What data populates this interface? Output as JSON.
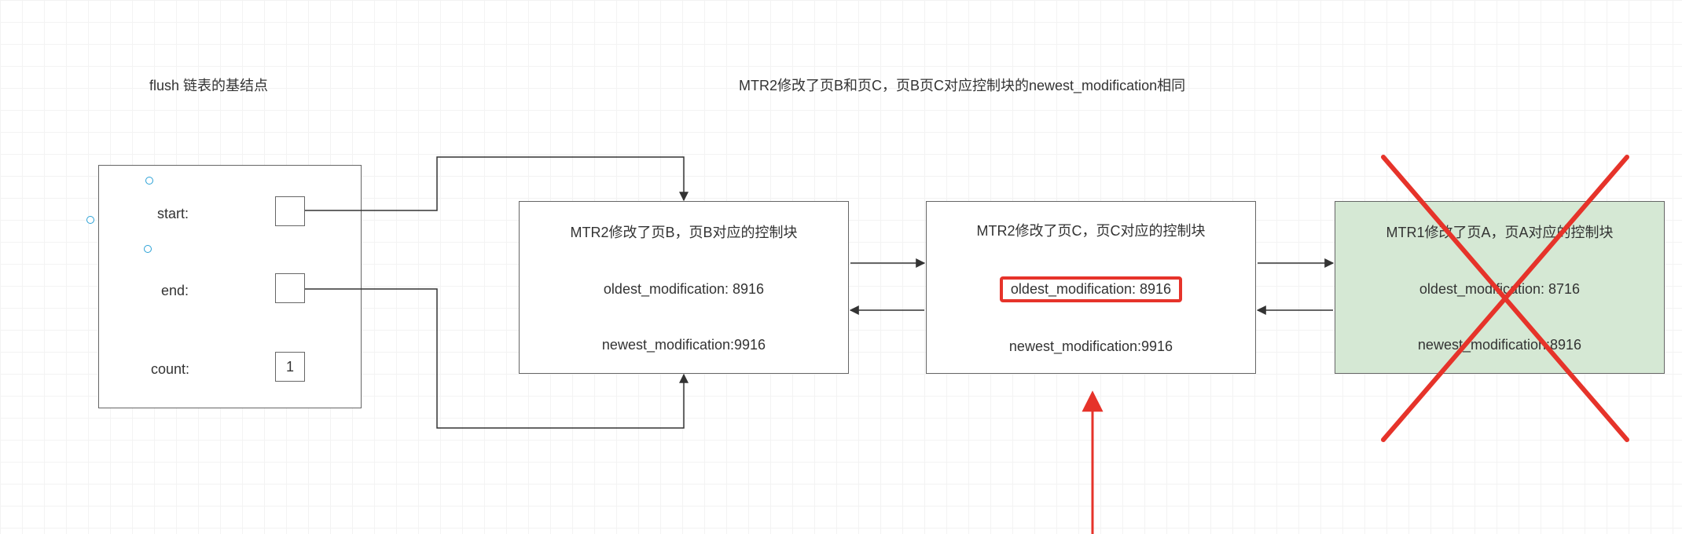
{
  "labels": {
    "flush_title": "flush 链表的基结点",
    "mtr2_title": "MTR2修改了页B和页C，页B页C对应控制块的newest_modification相同",
    "start": "start:",
    "end": "end:",
    "count": "count:",
    "count_value": "1"
  },
  "blockB": {
    "title": "MTR2修改了页B，页B对应的控制块",
    "oldest": "oldest_modification: 8916",
    "newest": "newest_modification:9916"
  },
  "blockC": {
    "title": "MTR2修改了页C，页C对应的控制块",
    "oldest": "oldest_modification: 8916",
    "newest": "newest_modification:9916"
  },
  "blockA": {
    "title": "MTR1修改了页A，页A对应的控制块",
    "oldest": "oldest_modification: 8716",
    "newest": "newest_modification:8916"
  }
}
